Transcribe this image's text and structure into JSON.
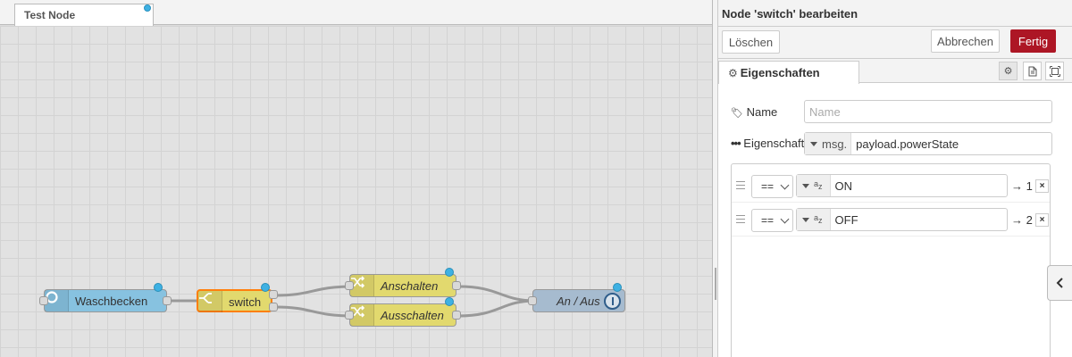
{
  "workspace": {
    "tab_label": "Test Node",
    "nodes": {
      "waschbecken": "Waschbecken",
      "switch": "switch",
      "anschalten": "Anschalten",
      "ausschalten": "Ausschalten",
      "anaus": "An / Aus"
    }
  },
  "editor": {
    "title": "Node 'switch' bearbeiten",
    "delete_label": "Löschen",
    "cancel_label": "Abbrechen",
    "done_label": "Fertig",
    "properties_tab": "Eigenschaften",
    "name_label": "Name",
    "name_placeholder": "Name",
    "property_label": "Eigenschaft",
    "property_type": "msg.",
    "property_value": "payload.powerState",
    "rules": [
      {
        "operator": "==",
        "value": "ON",
        "output": "→ 1"
      },
      {
        "operator": "==",
        "value": "OFF",
        "output": "→ 2"
      }
    ],
    "delete_rule_glyph": "×"
  },
  "colors": {
    "accent_red": "#ad1625",
    "badge_blue": "#3eb1e3",
    "node_input": "#87c2e0",
    "node_switch": "#e2d96e",
    "node_change": "#e2d96e",
    "node_output": "#a6bbcf"
  },
  "icons": [
    "gear-icon",
    "tag-icon",
    "dots-icon",
    "description-icon",
    "appearance-icon",
    "chevron-left-icon",
    "drag-handle-icon"
  ]
}
